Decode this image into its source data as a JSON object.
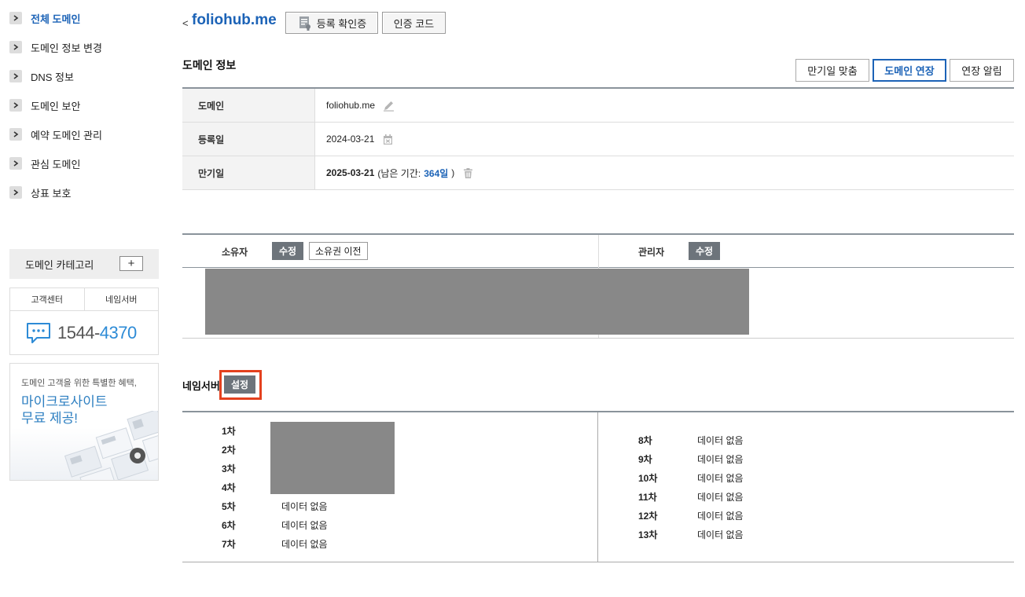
{
  "sidebar": {
    "items": [
      {
        "label": "전체 도메인",
        "active": true
      },
      {
        "label": "도메인 정보 변경"
      },
      {
        "label": "DNS 정보"
      },
      {
        "label": "도메인 보안"
      },
      {
        "label": "예약 도메인 관리"
      },
      {
        "label": "관심 도메인"
      },
      {
        "label": "상표 보호"
      }
    ],
    "category_label": "도메인 카테고리",
    "category_add": "+",
    "support_tabs": [
      "고객센터",
      "네임서버"
    ],
    "phone_prefix": "1544-",
    "phone_suffix": "4370",
    "promo_small": "도메인 고객을 위한 특별한 혜택,",
    "promo_big_line1": "마이크로사이트",
    "promo_big_line2": "무료 제공!"
  },
  "header": {
    "back": "<",
    "domain": "foliohub.me",
    "reg_cert_label": "등록 확인증",
    "auth_code_label": "인증 코드"
  },
  "domain_info": {
    "title": "도메인 정보",
    "buttons": {
      "match_expiry": "만기일 맞춤",
      "extend": "도메인 연장",
      "extend_notice": "연장 알림"
    },
    "rows": {
      "domain_label": "도메인",
      "domain_value": "foliohub.me",
      "reg_label": "등록일",
      "reg_value": "2024-03-21",
      "exp_label": "만기일",
      "exp_value": "2025-03-21",
      "remain_prefix": "(남은 기간:",
      "remain_days": "364일",
      "remain_suffix": ")"
    }
  },
  "contacts": {
    "owner_label": "소유자",
    "owner_edit": "수정",
    "owner_transfer": "소유권 이전",
    "admin_label": "관리자",
    "admin_edit": "수정"
  },
  "nameservers": {
    "title": "네임서버",
    "settings": "설정",
    "left": [
      {
        "k": "1차",
        "v": ""
      },
      {
        "k": "2차",
        "v": ""
      },
      {
        "k": "3차",
        "v": ""
      },
      {
        "k": "4차",
        "v": ""
      },
      {
        "k": "5차",
        "v": "데이터 없음"
      },
      {
        "k": "6차",
        "v": "데이터 없음"
      },
      {
        "k": "7차",
        "v": "데이터 없음"
      }
    ],
    "right": [
      {
        "k": "8차",
        "v": "데이터 없음"
      },
      {
        "k": "9차",
        "v": "데이터 없음"
      },
      {
        "k": "10차",
        "v": "데이터 없음"
      },
      {
        "k": "11차",
        "v": "데이터 없음"
      },
      {
        "k": "12차",
        "v": "데이터 없음"
      },
      {
        "k": "13차",
        "v": "데이터 없음"
      }
    ]
  },
  "colors": {
    "accent": "#1c63b7",
    "highlight": "#e4411e",
    "button_dark": "#6d747b",
    "redacted": "#888888"
  }
}
